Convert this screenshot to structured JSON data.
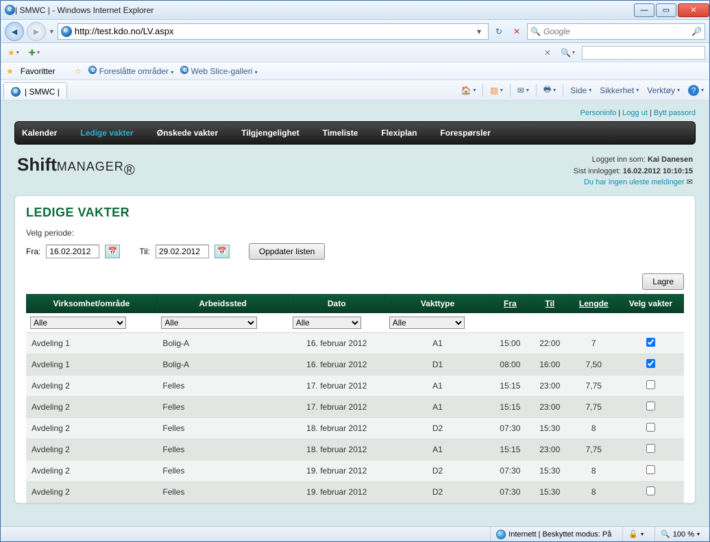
{
  "window": {
    "title": "| SMWC | - Windows Internet Explorer"
  },
  "address": {
    "url": "http://test.kdo.no/LV.aspx"
  },
  "search": {
    "placeholder": "Google"
  },
  "favbar": {
    "fav": "Favoritter",
    "suggested": "Foreslåtte områder",
    "slice": "Web Slice-galleri"
  },
  "tab": {
    "title": "| SMWC |"
  },
  "cmdbar": {
    "side": "Side",
    "sikkerhet": "Sikkerhet",
    "verktoy": "Verktøy"
  },
  "toplinks": {
    "personinfo": "Personinfo",
    "loggut": "Logg ut",
    "bytt": "Bytt passord"
  },
  "nav": {
    "kalender": "Kalender",
    "ledige": "Ledige vakter",
    "onskede": "Ønskede vakter",
    "tilg": "Tilgjengelighet",
    "timeliste": "Timeliste",
    "flexi": "Flexiplan",
    "foresp": "Forespørsler"
  },
  "user": {
    "logged_label": "Logget inn som:",
    "name": "Kai Danesen",
    "last_label": "Sist innlogget:",
    "last": "16.02.2012 10:10:15",
    "nomsg": "Du har ingen uleste meldinger"
  },
  "page": {
    "title": "LEDIGE VAKTER",
    "velg_periode": "Velg periode:",
    "fra": "Fra:",
    "til": "Til:",
    "fra_val": "16.02.2012",
    "til_val": "29.02.2012",
    "oppdater": "Oppdater listen",
    "lagre": "Lagre"
  },
  "headers": {
    "virksomhet": "Virksomhet/område",
    "arbeidssted": "Arbeidssted",
    "dato": "Dato",
    "vakttype": "Vakttype",
    "fra": "Fra",
    "til": "Til",
    "lengde": "Lengde",
    "velg": "Velg vakter"
  },
  "filters": {
    "alle": "Alle"
  },
  "rows": [
    {
      "virk": "Avdeling 1",
      "arb": "Bolig-A",
      "dato": "16. februar 2012",
      "type": "A1",
      "fra": "15:00",
      "til": "22:00",
      "len": "7",
      "chk": true
    },
    {
      "virk": "Avdeling 1",
      "arb": "Bolig-A",
      "dato": "16. februar 2012",
      "type": "D1",
      "fra": "08:00",
      "til": "16:00",
      "len": "7,50",
      "chk": true
    },
    {
      "virk": "Avdeling 2",
      "arb": "Felles",
      "dato": "17. februar 2012",
      "type": "A1",
      "fra": "15:15",
      "til": "23:00",
      "len": "7,75",
      "chk": false
    },
    {
      "virk": "Avdeling 2",
      "arb": "Felles",
      "dato": "17. februar 2012",
      "type": "A1",
      "fra": "15:15",
      "til": "23:00",
      "len": "7,75",
      "chk": false
    },
    {
      "virk": "Avdeling 2",
      "arb": "Felles",
      "dato": "18. februar 2012",
      "type": "D2",
      "fra": "07:30",
      "til": "15:30",
      "len": "8",
      "chk": false
    },
    {
      "virk": "Avdeling 2",
      "arb": "Felles",
      "dato": "18. februar 2012",
      "type": "A1",
      "fra": "15:15",
      "til": "23:00",
      "len": "7,75",
      "chk": false
    },
    {
      "virk": "Avdeling 2",
      "arb": "Felles",
      "dato": "19. februar 2012",
      "type": "D2",
      "fra": "07:30",
      "til": "15:30",
      "len": "8",
      "chk": false
    },
    {
      "virk": "Avdeling 2",
      "arb": "Felles",
      "dato": "19. februar 2012",
      "type": "D2",
      "fra": "07:30",
      "til": "15:30",
      "len": "8",
      "chk": false
    }
  ],
  "status": {
    "zone": "Internett | Beskyttet modus: På",
    "zoom": "100 %"
  }
}
